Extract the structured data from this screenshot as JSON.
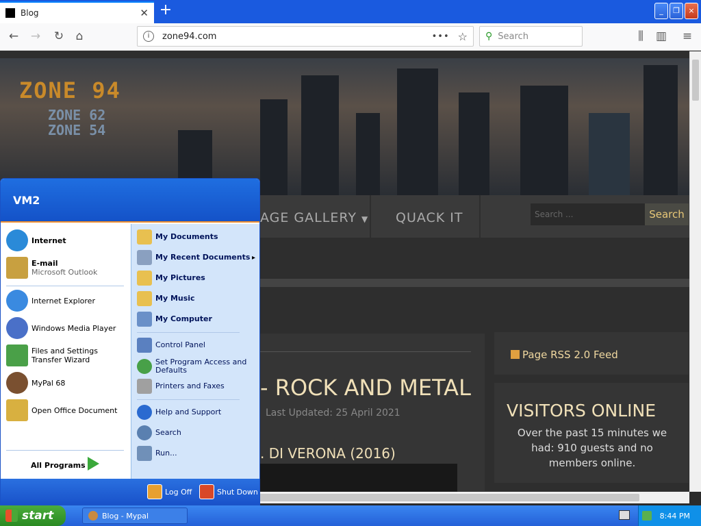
{
  "browser": {
    "tab_title": "Blog",
    "new_tab": "+",
    "url": "zone94.com",
    "search_placeholder": "Search",
    "window_buttons": [
      "_",
      "❐",
      "×"
    ]
  },
  "site": {
    "logo_main": "ZONE 94",
    "logo_sub1": "ZONE 62",
    "logo_sub2": "ZONE 54",
    "menu": [
      "AGE GALLERY",
      "QUACK IT"
    ],
    "search_placeholder": "Search ...",
    "search_button": "Search",
    "article_title": "- ROCK AND METAL",
    "article_meta": "Last Updated: 25 April 2021",
    "article_sub": ". DI VERONA (2016)",
    "rss": "Page RSS 2.0 Feed",
    "visitors_title": "VISITORS ONLINE",
    "visitors_text": "Over the past 15 minutes we had: 910 guests and no members online."
  },
  "start_menu": {
    "user": "VM2",
    "left_items": [
      {
        "title": "Internet",
        "subtitle": "",
        "color": "#2a8ad8"
      },
      {
        "title": "E-mail",
        "subtitle": "Microsoft Outlook",
        "color": "#c8a040"
      },
      {
        "title": "Internet Explorer",
        "subtitle": "",
        "color": "#3a8ae0"
      },
      {
        "title": "Windows Media Player",
        "subtitle": "",
        "color": "#4a70c8"
      },
      {
        "title": "Files and Settings Transfer Wizard",
        "subtitle": "",
        "color": "#4aa048"
      },
      {
        "title": "MyPal 68",
        "subtitle": "",
        "color": "#7a5030"
      },
      {
        "title": "Open Office Document",
        "subtitle": "",
        "color": "#d8b040"
      }
    ],
    "all_programs": "All Programs",
    "right_items": [
      {
        "label": "My Documents",
        "bold": true,
        "color": "#e8c050"
      },
      {
        "label": "My Recent Documents",
        "bold": true,
        "color": "#8aa0c0",
        "arrow": "▸"
      },
      {
        "label": "My Pictures",
        "bold": true,
        "color": "#e8c050"
      },
      {
        "label": "My Music",
        "bold": true,
        "color": "#e8c050"
      },
      {
        "label": "My Computer",
        "bold": true,
        "color": "#6a90c8"
      },
      {
        "label": "Control Panel",
        "bold": false,
        "color": "#5a80c0"
      },
      {
        "label": "Set Program Access and Defaults",
        "bold": false,
        "color": "#48a048"
      },
      {
        "label": "Printers and Faxes",
        "bold": false,
        "color": "#a0a0a0"
      },
      {
        "label": "Help and Support",
        "bold": false,
        "color": "#2a6ad0"
      },
      {
        "label": "Search",
        "bold": false,
        "color": "#5a80b0"
      },
      {
        "label": "Run...",
        "bold": false,
        "color": "#7090b8"
      }
    ],
    "log_off": "Log Off",
    "shut_down": "Shut Down"
  },
  "taskbar": {
    "start": "start",
    "task": "Blog - Mypal",
    "clock": "8:44 PM"
  }
}
